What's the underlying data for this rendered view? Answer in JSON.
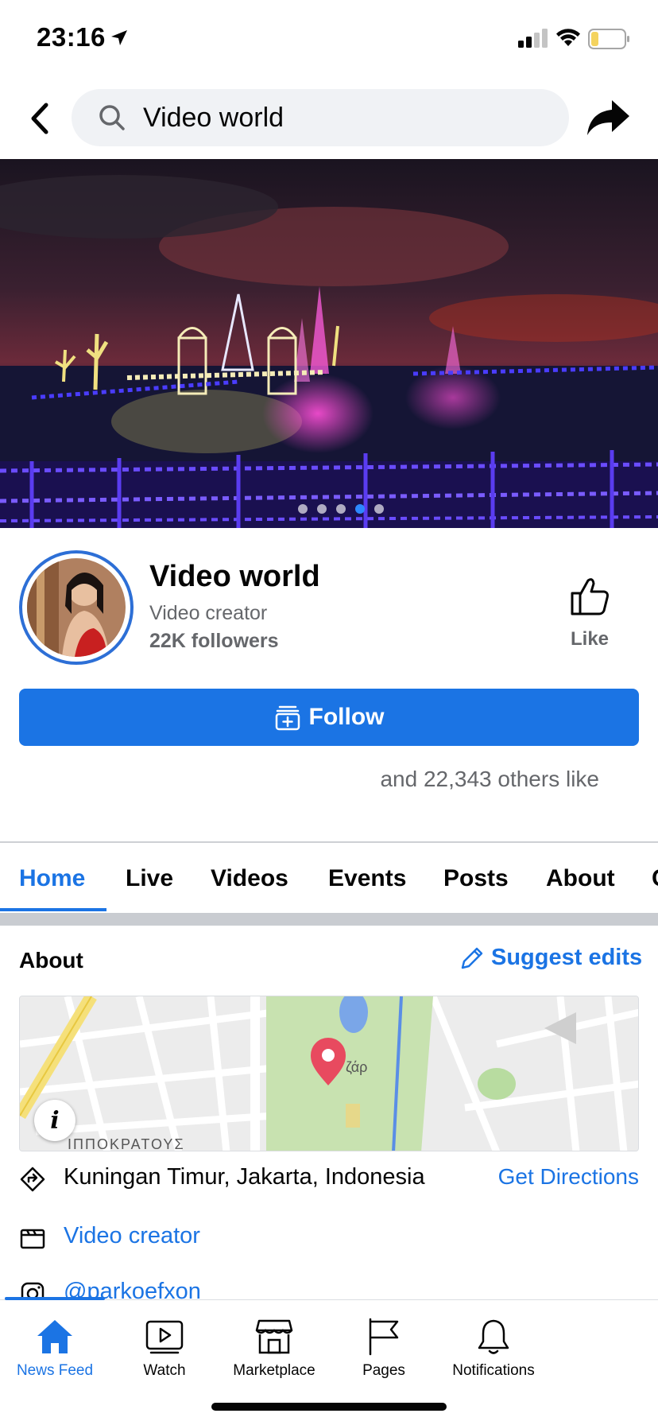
{
  "status_bar": {
    "time": "23:16"
  },
  "header": {
    "search_value": "Video world"
  },
  "cover": {
    "slide_count": 5,
    "active_slide": 4
  },
  "profile": {
    "name": "Video world",
    "category": "Video creator",
    "followers": "22K followers",
    "like_label": "Like",
    "follow_label": "Follow",
    "likes_text": "and 22,343 others like"
  },
  "tabs": [
    {
      "label": "Home",
      "active": true
    },
    {
      "label": "Live"
    },
    {
      "label": "Videos"
    },
    {
      "label": "Events"
    },
    {
      "label": "Posts"
    },
    {
      "label": "About"
    }
  ],
  "about": {
    "title": "About",
    "suggest_label": "Suggest edits",
    "map_label": "ζάρ",
    "location": "Kuningan Timur, Jakarta, Indonesia",
    "directions_label": "Get Directions",
    "category": "Video creator",
    "instagram": "@parkoefxon"
  },
  "bottom_nav": [
    {
      "label": "News Feed",
      "icon": "home-icon",
      "active": true
    },
    {
      "label": "Watch",
      "icon": "watch-icon"
    },
    {
      "label": "Marketplace",
      "icon": "marketplace-icon"
    },
    {
      "label": "Pages",
      "icon": "flag-icon"
    },
    {
      "label": "Notifications",
      "icon": "bell-icon"
    }
  ],
  "colors": {
    "accent": "#1b74e4",
    "secondary_text": "#65676b",
    "search_bg": "#f0f2f5"
  }
}
